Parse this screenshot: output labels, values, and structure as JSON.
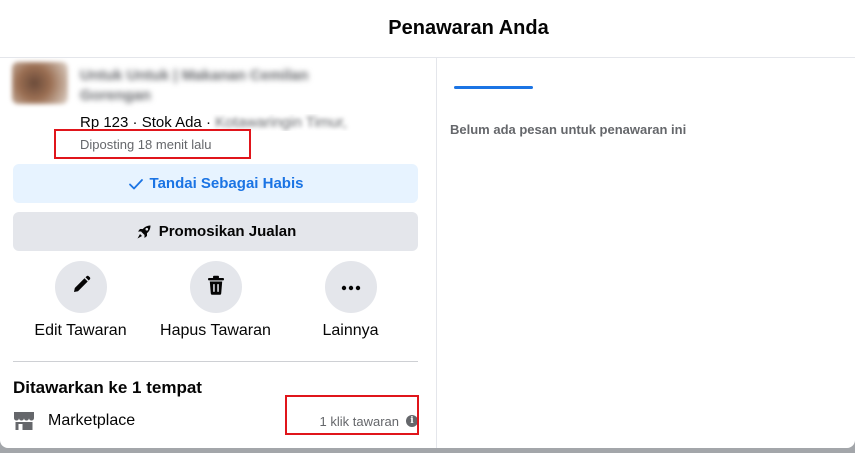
{
  "modal": {
    "title": "Penawaran Anda"
  },
  "listing": {
    "title": "Untuk Untuk | Makanan Cemilan Gorengan",
    "price": "Rp 123",
    "stock": "Stok Ada",
    "location": "Kotawaringin Timur,",
    "posted": "Diposting 18 menit lalu"
  },
  "buttons": {
    "mark_sold": "Tandai Sebagai Habis",
    "promote": "Promosikan Jualan"
  },
  "actions": [
    {
      "label": "Edit Tawaran",
      "icon": "pencil-icon"
    },
    {
      "label": "Hapus Tawaran",
      "icon": "trash-icon"
    },
    {
      "label": "Lainnya",
      "icon": "more-icon"
    }
  ],
  "offered": {
    "heading": "Ditawarkan ke 1 tempat",
    "place": "Marketplace",
    "clicks": "1 klik tawaran"
  },
  "messages": {
    "empty": "Belum ada pesan untuk penawaran ini"
  },
  "colors": {
    "accent": "#1b74e4",
    "highlight": "#e0151b"
  }
}
